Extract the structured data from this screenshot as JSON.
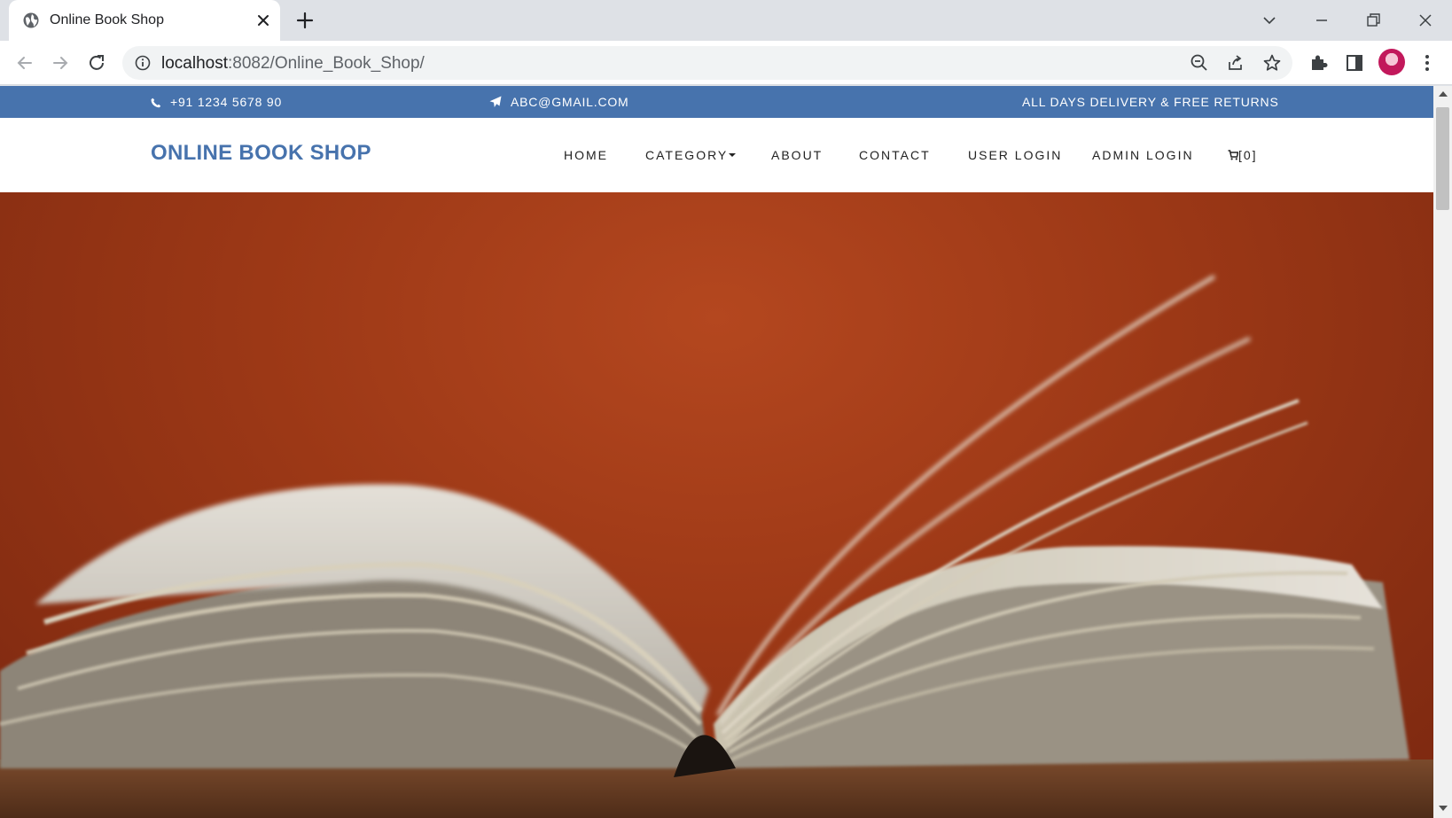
{
  "browser": {
    "tab_title": "Online Book Shop",
    "url_host": "localhost",
    "url_path": ":8082/Online_Book_Shop/"
  },
  "topbar": {
    "phone": "+91 1234 5678 90",
    "email": "ABC@GMAIL.COM",
    "promo": "ALL DAYS DELIVERY & FREE RETURNS"
  },
  "navbar": {
    "brand": "ONLINE BOOK SHOP",
    "items": {
      "home": "HOME",
      "category": "CATEGORY",
      "about": "ABOUT",
      "contact": "CONTACT",
      "user_login": "USER LOGIN",
      "admin_login": "ADMIN LOGIN",
      "cart": "[0]"
    }
  },
  "colors": {
    "brand_blue": "#4773ad",
    "hero_background": "#9c3816"
  },
  "icons": [
    "globe-icon",
    "close-icon",
    "plus-icon",
    "back-arrow-icon",
    "forward-arrow-icon",
    "reload-icon",
    "info-icon",
    "zoom-out-icon",
    "share-icon",
    "star-icon",
    "extensions-icon",
    "side-panel-icon",
    "menu-icon",
    "phone-icon",
    "paper-plane-icon",
    "cart-icon"
  ]
}
